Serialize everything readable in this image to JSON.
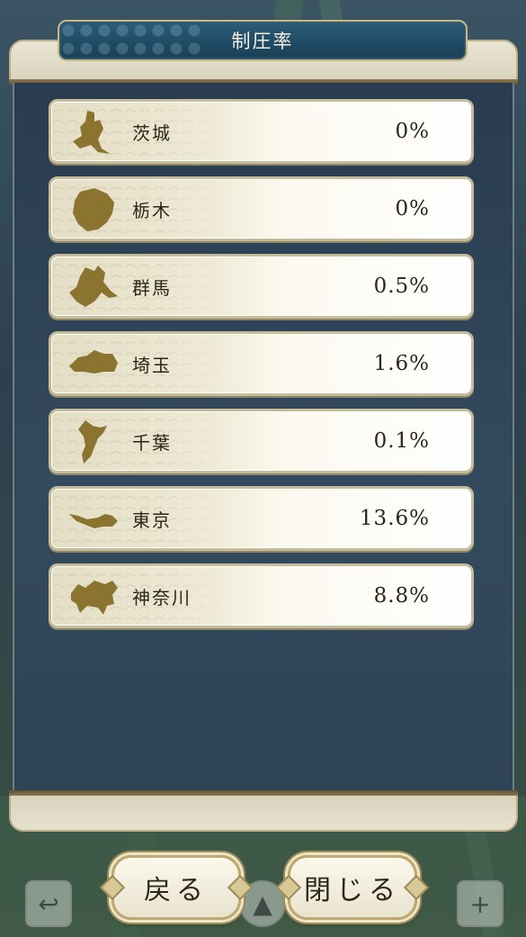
{
  "title": "制圧率",
  "colors": {
    "banner": "#1f4a63",
    "panel": "#2f4456",
    "row_bg": "#fbf9ef",
    "silhouette": "#8a7430",
    "text": "#2a2618"
  },
  "rows": [
    {
      "icon": "ibaraki-silhouette-icon",
      "name": "茨城",
      "value": "0%"
    },
    {
      "icon": "tochigi-silhouette-icon",
      "name": "栃木",
      "value": "0%"
    },
    {
      "icon": "gunma-silhouette-icon",
      "name": "群馬",
      "value": "0.5%"
    },
    {
      "icon": "saitama-silhouette-icon",
      "name": "埼玉",
      "value": "1.6%"
    },
    {
      "icon": "chiba-silhouette-icon",
      "name": "千葉",
      "value": "0.1%"
    },
    {
      "icon": "tokyo-silhouette-icon",
      "name": "東京",
      "value": "13.6%"
    },
    {
      "icon": "kanagawa-silhouette-icon",
      "name": "神奈川",
      "value": "8.8%"
    }
  ],
  "buttons": {
    "back_label": "戻る",
    "close_label": "閉じる"
  },
  "map_icons": {
    "left": "return-arrow-icon",
    "center": "compass-icon",
    "right": "zoom-plus-icon"
  }
}
